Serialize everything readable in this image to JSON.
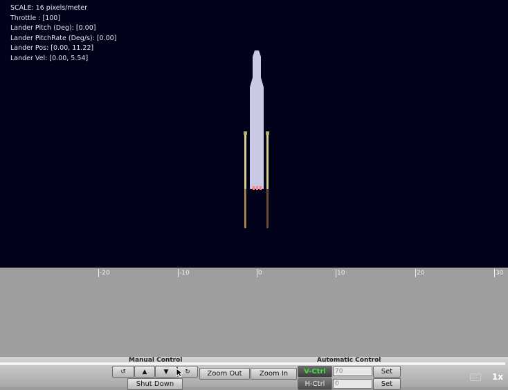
{
  "hud": {
    "scale": "SCALE: 16 pixels/meter",
    "throttle": "Throttle : [100]",
    "pitch": "Lander Pitch (Deg): [0.00]",
    "pitch_rate": "Lander PitchRate (Deg/s): [0.00]",
    "pos": "Lander Pos: [0.00, 11.22]",
    "vel": "Lander Vel: [0.00, 5.54]"
  },
  "ruler": {
    "ticks": [
      "-20",
      "-10",
      "0",
      "10",
      "20",
      "30"
    ]
  },
  "manual_control": {
    "label": "Manual Control",
    "rotate_ccw_icon": "↺",
    "up_icon": "▲",
    "down_icon": "▼",
    "rotate_cw_icon": "↻",
    "shutdown_label": "Shut Down"
  },
  "zoom": {
    "zoom_out_label": "Zoom Out",
    "zoom_in_label": "Zoom In"
  },
  "automatic_control": {
    "label": "Automatic Control",
    "vctrl_label": "V-Ctrl",
    "vctrl_value": "70",
    "set_label": "Set",
    "hctrl_label": "H-Ctrl",
    "hctrl_value": "0"
  },
  "player": {
    "cc_label": "CC",
    "speed_label": "1x"
  },
  "colors": {
    "sky": "#02021a",
    "ground": "#9e9e9e",
    "lander_body": "#c9c9e6",
    "leg": "#c8c070",
    "flame": "#ff8080"
  }
}
